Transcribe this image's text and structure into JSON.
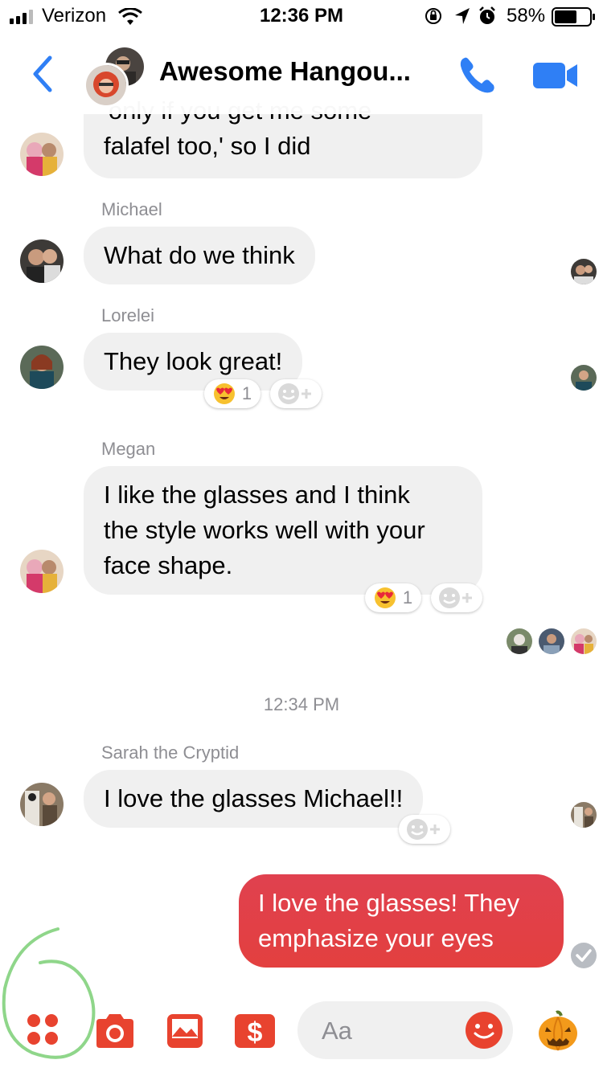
{
  "status_bar": {
    "carrier": "Verizon",
    "time": "12:36 PM",
    "battery": "58%"
  },
  "header": {
    "title": "Awesome Hangou..."
  },
  "messages": [
    {
      "sender": "",
      "text_partial": "'only if you get me some",
      "text": "falafel too,' so I did"
    },
    {
      "sender": "Michael",
      "text": "What do we think"
    },
    {
      "sender": "Lorelei",
      "text": "They look great!",
      "reaction_count": "1"
    },
    {
      "sender": "Megan",
      "lines": [
        "I like the glasses and I think",
        "the style works well with your",
        "face shape."
      ],
      "reaction_count": "1"
    },
    {
      "sender": "Sarah the Cryptid",
      "text": "I love the glasses Michael!!"
    },
    {
      "sender": "me",
      "lines": [
        "I love the glasses! They",
        "emphasize your eyes"
      ]
    }
  ],
  "timestamp": "12:34 PM",
  "composer": {
    "placeholder": "Aa"
  },
  "colors": {
    "accent_blue": "#2f7ff5",
    "accent_red": "#e8432f",
    "bubble_gray": "#f0f0f0",
    "my_bubble": "#e0414f",
    "annotation_green": "#8fd68a"
  },
  "icons": [
    "back-chevron-icon",
    "phone-icon",
    "video-camera-icon",
    "apps-grid-icon",
    "camera-icon",
    "gallery-icon",
    "payment-icon",
    "emoji-icon",
    "pumpkin-icon",
    "heart-eyes-emoji-icon",
    "add-reaction-icon",
    "seen-check-icon"
  ]
}
